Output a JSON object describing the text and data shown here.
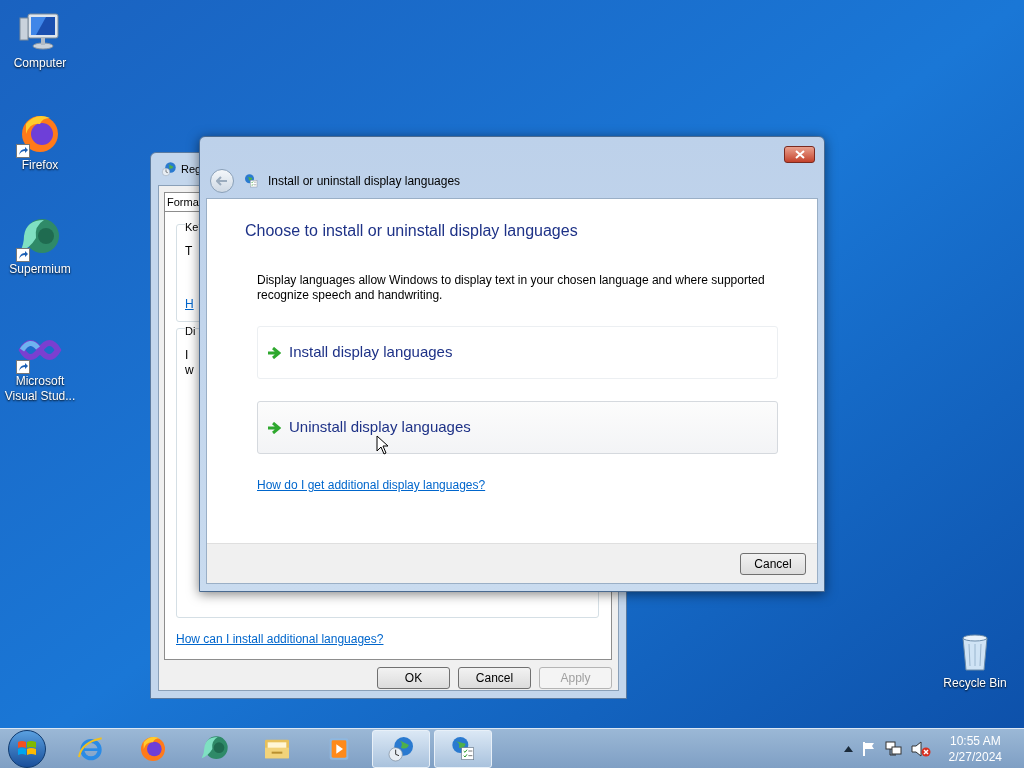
{
  "desktop_icons": [
    {
      "kind": "computer",
      "label": "Computer",
      "shortcut": false
    },
    {
      "kind": "firefox",
      "label": "Firefox",
      "shortcut": true
    },
    {
      "kind": "supermium",
      "label": "Supermium",
      "shortcut": true
    },
    {
      "kind": "visual-studio",
      "label": "Microsoft Visual Stud...",
      "shortcut": true
    }
  ],
  "recycle_bin": {
    "label": "Recycle Bin"
  },
  "background_window": {
    "title": "Reg",
    "tabs": [
      {
        "label": "Forma",
        "selected": true
      }
    ],
    "groups": [
      {
        "title": "Ke",
        "lines": [
          "T"
        ],
        "link": "H"
      },
      {
        "title": "Di",
        "lines": [
          "I",
          "w"
        ]
      }
    ],
    "link": "How can I install additional languages?",
    "buttons": [
      {
        "label": "OK",
        "disabled": false
      },
      {
        "label": "Cancel",
        "disabled": false
      },
      {
        "label": "Apply",
        "disabled": true
      }
    ]
  },
  "dialog": {
    "title": "Install or uninstall display languages",
    "heading": "Choose to install or uninstall display languages",
    "description": "Display languages allow Windows to display text in your chosen language and where supported recognize speech and handwriting.",
    "options": [
      {
        "label": "Install display languages",
        "hovered": false
      },
      {
        "label": "Uninstall display languages",
        "hovered": true
      }
    ],
    "link": "How do I get additional display languages?",
    "buttons": [
      "Cancel"
    ]
  },
  "taskbar": {
    "apps": [
      {
        "kind": "internet-explorer",
        "active": false
      },
      {
        "kind": "firefox",
        "active": false
      },
      {
        "kind": "supermium",
        "active": false
      },
      {
        "kind": "file-explorer",
        "active": false
      },
      {
        "kind": "media-player",
        "active": false
      },
      {
        "kind": "region",
        "active": true
      },
      {
        "kind": "language",
        "active": true
      }
    ],
    "clock": {
      "time": "10:55 AM",
      "date": "2/27/2024"
    }
  }
}
